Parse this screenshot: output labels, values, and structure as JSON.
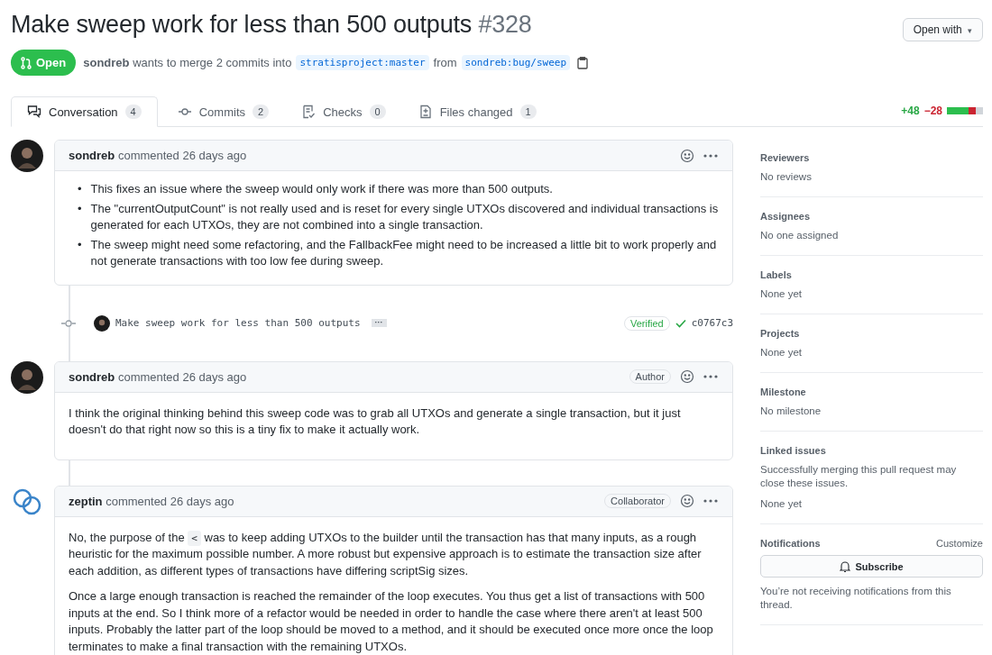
{
  "header": {
    "title": "Make sweep work for less than 500 outputs",
    "number": "#328",
    "open_with": "Open with",
    "caret": "▾"
  },
  "state": {
    "label": "Open",
    "author": "sondreb",
    "summary": "wants to merge 2 commits into",
    "base": "stratisproject:master",
    "from": "from",
    "head": "sondreb:bug/sweep"
  },
  "tabs": [
    {
      "label": "Conversation",
      "count": "4",
      "selected": true
    },
    {
      "label": "Commits",
      "count": "2",
      "selected": false
    },
    {
      "label": "Checks",
      "count": "0",
      "selected": false
    },
    {
      "label": "Files changed",
      "count": "1",
      "selected": false
    }
  ],
  "diffstat": {
    "additions": "+48",
    "deletions": "−28",
    "blocks": [
      {
        "color": "#2cbe4e"
      },
      {
        "color": "#2cbe4e"
      },
      {
        "color": "#2cbe4e"
      },
      {
        "color": "#cb2431"
      },
      {
        "color": "#d1d5da"
      }
    ]
  },
  "timeline": [
    {
      "kind": "comment",
      "avatar": {
        "kind": "picture"
      },
      "author": "sondreb",
      "meta": "commented 26 days ago",
      "body": [
        {
          "kind": "list",
          "marker": "•",
          "items": [
            "This fixes an issue where the sweep would only work if there was more than 500 outputs.",
            "The \"currentOutputCount\" is not really used and is reset for every single UTXOs discovered and individual transactions is generated for each UTXOs, they are not combined into a single transaction.",
            "The sweep might need some refactoring, and the FallbackFee might need to be increased a little bit to work properly and not generate transactions with too low fee during sweep."
          ]
        }
      ]
    },
    {
      "kind": "commit",
      "message": "Make sweep work for less than 500 outputs",
      "more": "···",
      "verified": "Verified",
      "sha": "c0767c3"
    },
    {
      "kind": "comment",
      "avatar": {
        "kind": "picture"
      },
      "author": "sondreb",
      "meta": "commented 26 days ago",
      "badge": "Author",
      "body": [
        {
          "kind": "paragraph",
          "parts": [
            {
              "text": "I think the original thinking behind this sweep code was to grab all UTXOs and generate a single transaction, but it just doesn't do that right now so this is a tiny fix to make it actually work."
            }
          ]
        }
      ]
    },
    {
      "kind": "comment",
      "avatar": {
        "kind": "rings"
      },
      "author": "zeptin",
      "meta": "commented 26 days ago",
      "badge": "Collaborator",
      "body": [
        {
          "kind": "paragraph",
          "parts": [
            {
              "text": "No, the purpose of the "
            },
            {
              "code": "<"
            },
            {
              "text": " was to keep adding UTXOs to the builder until the transaction has that many inputs, as a rough heuristic for the maximum possible number. A more robust but expensive approach is to estimate the transaction size after each addition, as different types of transactions have differing scriptSig sizes."
            }
          ]
        },
        {
          "kind": "paragraph",
          "parts": [
            {
              "text": "Once a large enough transaction is reached the remainder of the loop executes. You thus get a list of transactions with 500 inputs at the end. So I think more of a refactor would be needed in order to handle the case where there aren't at least 500 inputs. Probably the latter part of the loop should be moved to a method, and it should be executed once more once the loop terminates to make a final transaction with the remaining UTXOs."
            }
          ]
        }
      ]
    }
  ],
  "sidebar": [
    {
      "heading": "Reviewers",
      "texts": [
        "No reviews"
      ]
    },
    {
      "heading": "Assignees",
      "texts": [
        "No one assigned"
      ]
    },
    {
      "heading": "Labels",
      "texts": [
        "None yet"
      ]
    },
    {
      "heading": "Projects",
      "texts": [
        "None yet"
      ]
    },
    {
      "heading": "Milestone",
      "texts": [
        "No milestone"
      ]
    },
    {
      "heading": "Linked issues",
      "texts": [
        "Successfully merging this pull request may close these issues.",
        "None yet"
      ]
    },
    {
      "heading": "Notifications",
      "action": "Customize",
      "button": "Subscribe",
      "texts": [
        "You’re not receiving notifications from this thread."
      ]
    }
  ]
}
